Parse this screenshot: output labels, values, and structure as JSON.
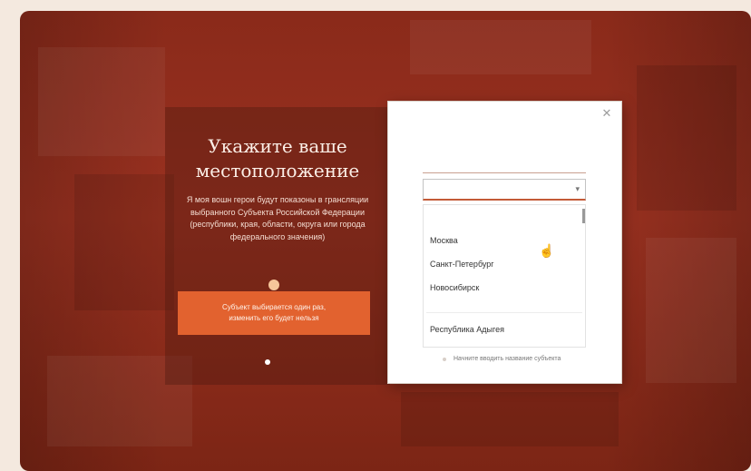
{
  "info": {
    "title_line1": "Укажите ваше",
    "title_line2": "местоположение",
    "description": "Я моя вошн герои будут показоны в грансляции выбранного Субъекта Российской Федерации (республики, края, области, округа или города федерального значения)"
  },
  "note": {
    "text": "Субъект выбирается один раз, изменить его будет нельзя"
  },
  "modal": {
    "close_icon": "close-icon",
    "select_value": "",
    "select_arrow_icon": "chevron-down-icon",
    "regions": [
      "Москва",
      "Санкт-Петербург",
      "Новосибирск",
      "Республика Адыгея"
    ],
    "footer_text": "Начните вводить название субъекта"
  },
  "colors": {
    "backdrop": "#8a2a1a",
    "accent": "#e2622f",
    "modal_bg": "#ffffff"
  }
}
